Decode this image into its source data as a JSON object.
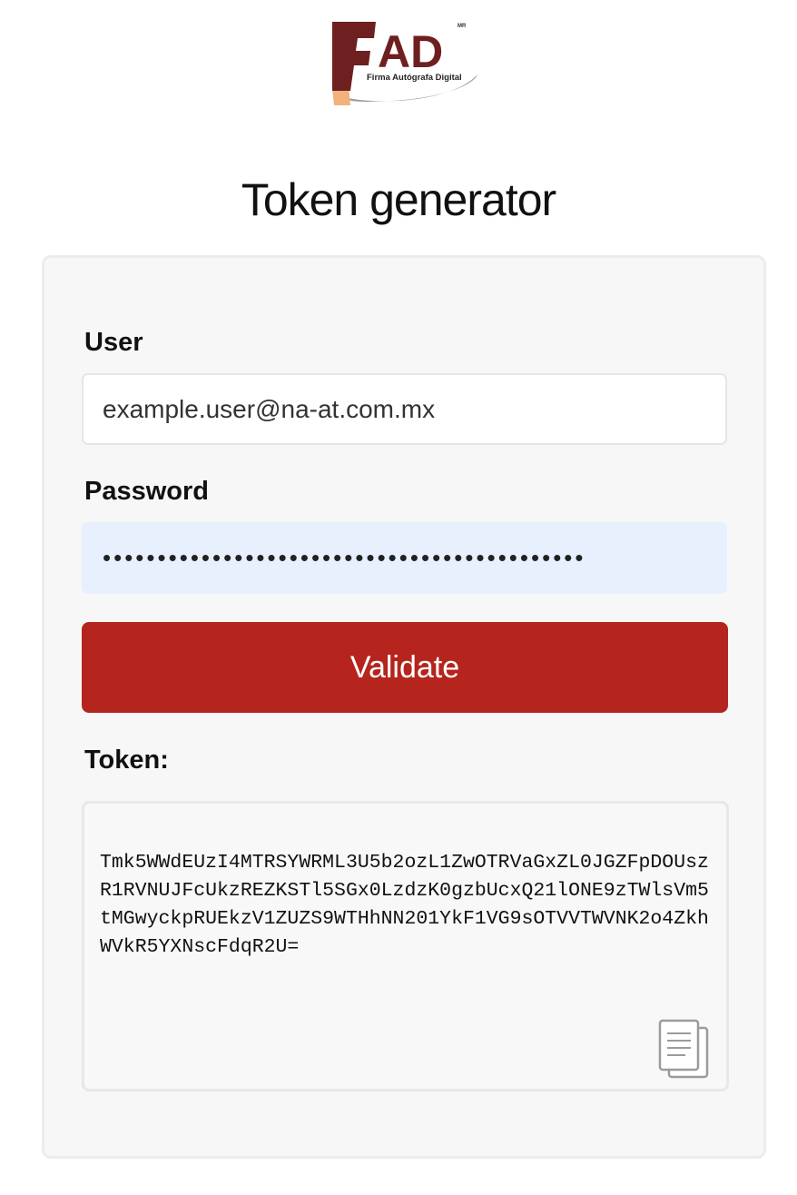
{
  "brand": {
    "logo_letters": "FAD",
    "logo_tagline": "Firma Autógrafa Digital",
    "logo_mark": "MR",
    "colors": {
      "primary_dark_red": "#6e1f1f",
      "skin_tone": "#f0b27a",
      "swoosh_gray": "#9a9a9a"
    }
  },
  "page": {
    "title": "Token generator"
  },
  "form": {
    "user": {
      "label": "User",
      "value": "example.user@na-at.com.mx"
    },
    "password": {
      "label": "Password",
      "masked_value": "••••••••••••••••••••••••••••••••••••••••••••"
    },
    "validate_label": "Validate",
    "validate_color": "#b5251d"
  },
  "token": {
    "label": "Token:",
    "value": "Tmk5WWdEUzI4MTRSYWRML3U5b2ozL1ZwOTRVaGxZL0JGZFpDOUszR1RVNUJFcUkzREZKSTl5SGx0LzdzK0gzbUcxQ21lONE9zTWlsVm5tMGwyckpRUEkzV1ZUZS9WTHhNN201YkF1VG9sOTVVTWVNK2o4ZkhWVkR5YXNscFdqR2U=",
    "copy_icon": "copy-icon"
  }
}
